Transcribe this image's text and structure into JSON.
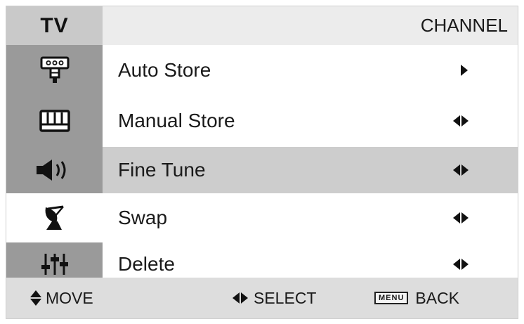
{
  "header": {
    "source": "TV",
    "title": "CHANNEL"
  },
  "menu": {
    "items": [
      {
        "label": "Auto Store",
        "icon": "antenna-connector-icon",
        "arrow": "right-arrow-icon"
      },
      {
        "label": "Manual Store",
        "icon": "keyboard-icon",
        "arrow": "left-right-arrow-icon"
      },
      {
        "label": "Fine Tune",
        "icon": "speaker-icon",
        "arrow": "left-right-arrow-icon",
        "selected": true
      },
      {
        "label": "Swap",
        "icon": "satellite-dish-icon",
        "arrow": "left-right-arrow-icon"
      },
      {
        "label": "Delete",
        "icon": "equalizer-sliders-icon",
        "arrow": "left-right-arrow-icon"
      }
    ]
  },
  "footer": {
    "move_label": "MOVE",
    "select_label": "SELECT",
    "menu_key": "MENU",
    "back_label": "BACK"
  },
  "colors": {
    "header_bg": "#ececec",
    "icon_column_bg": "#9a9a9a",
    "selected_row_bg": "#cdcdcd",
    "footer_bg": "#dddddd"
  }
}
